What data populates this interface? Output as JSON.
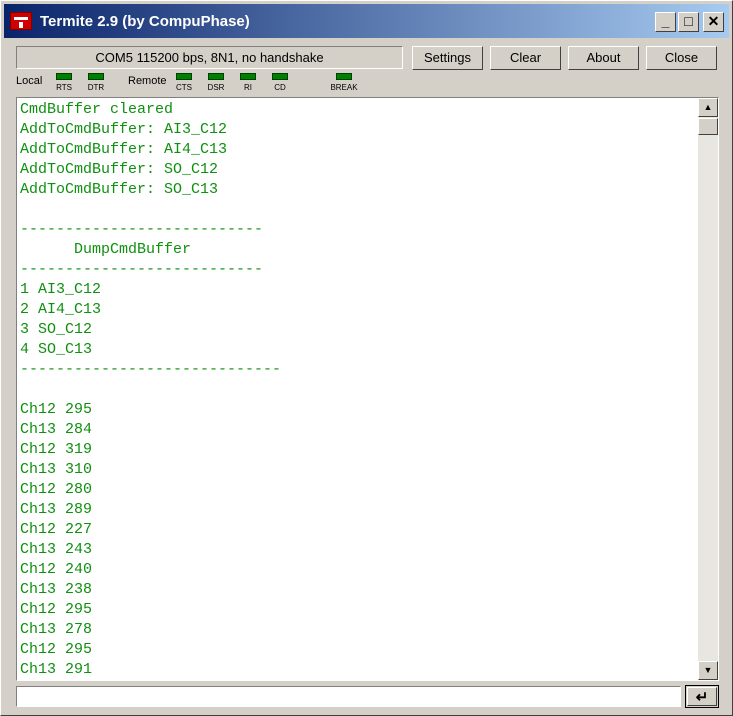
{
  "window": {
    "title": "Termite 2.9 (by CompuPhase)",
    "minimize_glyph": "_",
    "maximize_glyph": "□",
    "close_glyph": "✕"
  },
  "toolbar": {
    "status": "COM5 115200 bps, 8N1, no handshake",
    "settings_label": "Settings",
    "clear_label": "Clear",
    "about_label": "About",
    "close_label": "Close"
  },
  "indicators": {
    "local_label": "Local",
    "remote_label": "Remote",
    "local": [
      "RTS",
      "DTR"
    ],
    "remote": [
      "CTS",
      "DSR",
      "RI",
      "CD"
    ],
    "break": "BREAK",
    "led_color": "#008000"
  },
  "terminal": {
    "text_color": "#109010",
    "lines": [
      "CmdBuffer cleared",
      "AddToCmdBuffer: AI3_C12",
      "AddToCmdBuffer: AI4_C13",
      "AddToCmdBuffer: SO_C12",
      "AddToCmdBuffer: SO_C13",
      "",
      "---------------------------",
      "      DumpCmdBuffer",
      "---------------------------",
      "1 AI3_C12",
      "2 AI4_C13",
      "3 SO_C12",
      "4 SO_C13",
      "-----------------------------",
      "",
      "Ch12 295",
      "Ch13 284",
      "Ch12 319",
      "Ch13 310",
      "Ch12 280",
      "Ch13 289",
      "Ch12 227",
      "Ch13 243",
      "Ch12 240",
      "Ch13 238",
      "Ch12 295",
      "Ch13 278",
      "Ch12 295",
      "Ch13 291"
    ]
  },
  "scrollbar": {
    "up_glyph": "▲",
    "down_glyph": "▼"
  },
  "input": {
    "value": "",
    "send_glyph": "↵"
  }
}
